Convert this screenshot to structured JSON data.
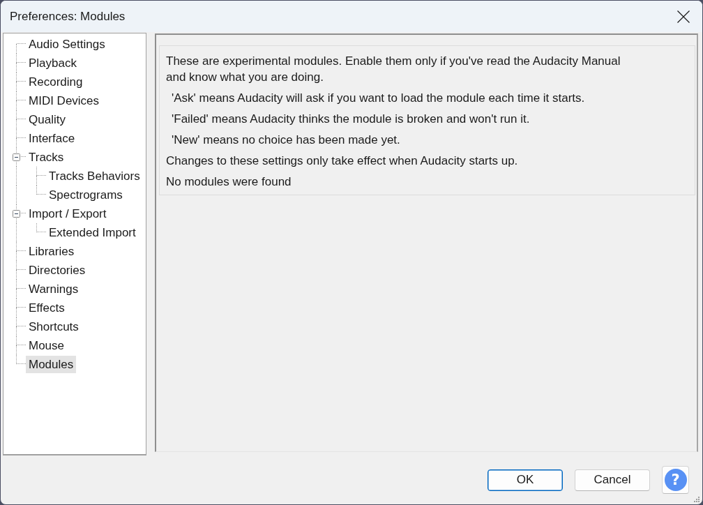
{
  "window": {
    "title": "Preferences: Modules"
  },
  "tree": [
    {
      "label": "Audio Settings",
      "selected": false
    },
    {
      "label": "Playback",
      "selected": false
    },
    {
      "label": "Recording",
      "selected": false
    },
    {
      "label": "MIDI Devices",
      "selected": false
    },
    {
      "label": "Quality",
      "selected": false
    },
    {
      "label": "Interface",
      "selected": false
    },
    {
      "label": "Tracks",
      "selected": false,
      "expanded": true,
      "children": [
        {
          "label": "Tracks Behaviors",
          "selected": false
        },
        {
          "label": "Spectrograms",
          "selected": false
        }
      ]
    },
    {
      "label": "Import / Export",
      "selected": false,
      "expanded": true,
      "children": [
        {
          "label": "Extended Import",
          "selected": false
        }
      ]
    },
    {
      "label": "Libraries",
      "selected": false
    },
    {
      "label": "Directories",
      "selected": false
    },
    {
      "label": "Warnings",
      "selected": false
    },
    {
      "label": "Effects",
      "selected": false
    },
    {
      "label": "Shortcuts",
      "selected": false
    },
    {
      "label": "Mouse",
      "selected": false
    },
    {
      "label": "Modules",
      "selected": true
    }
  ],
  "panel": {
    "messages": [
      {
        "kind": "plain",
        "lines": [
          "These are experimental modules. Enable them only if you've read the Audacity Manual",
          "and know what you are doing."
        ]
      },
      {
        "kind": "indented",
        "lines": [
          "'Ask' means Audacity will ask if you want to load the module each time it starts."
        ]
      },
      {
        "kind": "indented",
        "lines": [
          "'Failed' means Audacity thinks the module is broken and won't run it."
        ]
      },
      {
        "kind": "indented",
        "lines": [
          "'New' means no choice has been made yet."
        ]
      },
      {
        "kind": "plain",
        "lines": [
          "Changes to these settings only take effect when Audacity starts up."
        ]
      },
      {
        "kind": "plain",
        "lines": [
          "No modules were found"
        ]
      }
    ]
  },
  "buttons": [
    {
      "label": "OK",
      "focused": true
    },
    {
      "label": "Cancel",
      "focused": false
    }
  ],
  "help_button": {
    "label": "?"
  }
}
